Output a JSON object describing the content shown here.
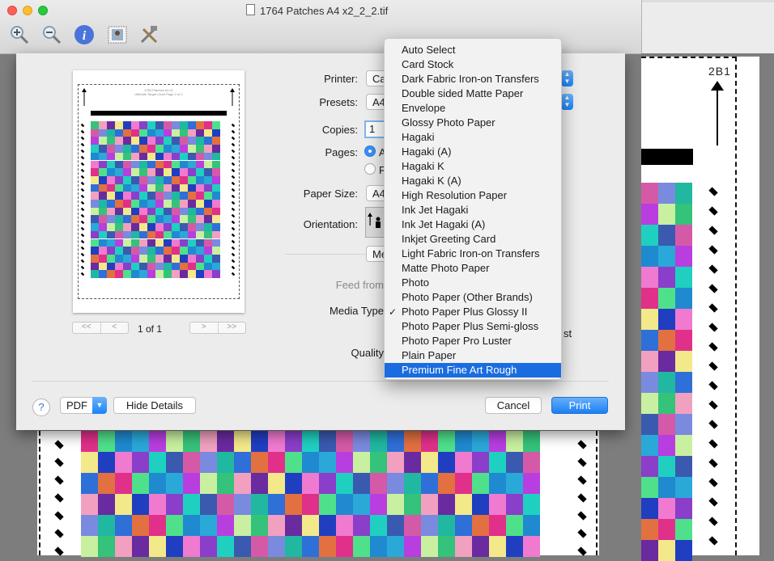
{
  "window": {
    "title": "1764 Patches A4 x2_2_2.tif"
  },
  "toolbar": {
    "tools": [
      "zoom-in-icon",
      "zoom-out-icon",
      "info-icon",
      "adjust-size-icon",
      "annotate-tools-icon"
    ]
  },
  "background_doc": {
    "label": "2B1"
  },
  "preview": {
    "title_line1": "1764 Patches A4 x2",
    "title_line2": "Ultimate Target Chart Page 2 of 2",
    "page_info": "1 of 1",
    "pager_first": "<<",
    "pager_prev": "<",
    "pager_next": ">",
    "pager_last": ">>"
  },
  "form": {
    "printer_label": "Printer:",
    "printer_value": "Ca",
    "presets_label": "Presets:",
    "presets_value": "A4",
    "copies_label": "Copies:",
    "copies_value": "1",
    "pages_label": "Pages:",
    "pages_all": "A",
    "pages_from": "F",
    "paper_size_label": "Paper Size:",
    "paper_size_value": "A4",
    "orientation_label": "Orientation:",
    "section_value": "Me",
    "feed_label": "Feed from",
    "media_type_label": "Media Type",
    "quality_label": "Quality",
    "partial_text": "st"
  },
  "footer": {
    "help": "?",
    "pdf": "PDF",
    "hide_details": "Hide Details",
    "cancel": "Cancel",
    "print": "Print"
  },
  "media_menu": {
    "items": [
      "Auto Select",
      "Card Stock",
      "Dark Fabric Iron-on Transfers",
      "Double sided Matte Paper",
      "Envelope",
      "Glossy Photo Paper",
      "Hagaki",
      "Hagaki (A)",
      "Hagaki K",
      "Hagaki K (A)",
      "High Resolution Paper",
      "Ink Jet Hagaki",
      "Ink Jet Hagaki (A)",
      "Inkjet Greeting Card",
      "Light Fabric Iron-on Transfers",
      "Matte Photo Paper",
      "Photo",
      "Photo Paper (Other Brands)",
      "Photo Paper Plus Glossy II",
      "Photo Paper Plus Semi-gloss",
      "Photo Paper Pro Luster",
      "Plain Paper",
      "Premium Fine Art Rough"
    ],
    "checked_index": 18,
    "highlighted_index": 22
  },
  "colors": {
    "accent": "#1a6de0",
    "patches": [
      "#e0308a",
      "#2aa8d8",
      "#35c27a",
      "#f3e98a",
      "#8a3ec9",
      "#d45aa8",
      "#2f6fd8",
      "#4fe08c",
      "#b83ee0",
      "#f2a0c0",
      "#203ec0",
      "#1fd0c0",
      "#7a8adf",
      "#e27040",
      "#1f8ad0",
      "#c8f0a0",
      "#6a2aa0",
      "#f07ad0",
      "#3a5ab0",
      "#20b8a0"
    ]
  }
}
